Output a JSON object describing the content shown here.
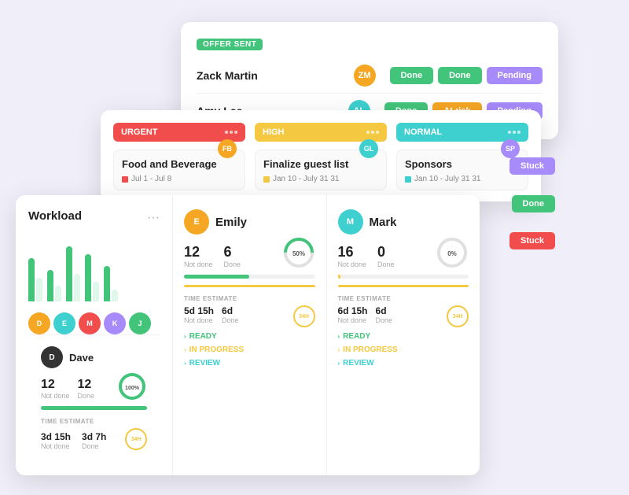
{
  "panels": {
    "back": {
      "badge": "OFFER SENT",
      "rows": [
        {
          "name": "Zack Martin",
          "avatarBg": "#f5a623",
          "initials": "ZM",
          "statuses": [
            "Done",
            "Done",
            "Pending"
          ]
        },
        {
          "name": "Amy Lee",
          "avatarBg": "#3ecfcf",
          "initials": "AL",
          "statuses": [
            "Done",
            "At risk",
            "Pending"
          ]
        }
      ],
      "statusColors": {
        "Done": "#43c47b",
        "At risk": "#f5a623",
        "Pending": "#a78bfa"
      }
    },
    "mid": {
      "columns": [
        {
          "id": "urgent",
          "label": "URGENT",
          "headerClass": "kanban-urgent",
          "card": {
            "title": "Food and Beverage",
            "date": "Jul 1 - Jul 8",
            "flagColor": "#f14d4d",
            "avatarBg": "#f5a623",
            "initials": "FB"
          }
        },
        {
          "id": "high",
          "label": "HIGH",
          "headerClass": "kanban-high",
          "card": {
            "title": "Finalize guest list",
            "date": "Jan 10 - July 31 31",
            "flagColor": "#f5a623",
            "avatarBg": "#3ecfcf",
            "initials": "GL"
          }
        },
        {
          "id": "normal",
          "label": "NORMAL",
          "headerClass": "kanban-normal",
          "card": {
            "title": "Sponsors",
            "date": "Jan 10 - July 31 31",
            "flagColor": "#3ecfcf",
            "avatarBg": "#a78bfa",
            "initials": "SP"
          }
        }
      ],
      "stuckLabel": "Stuck",
      "doneLabel": "Done"
    },
    "front": {
      "workload": {
        "title": "Workload",
        "dotsLabel": "...",
        "bars": [
          {
            "green": 55,
            "light": 30
          },
          {
            "green": 40,
            "light": 20
          },
          {
            "green": 70,
            "light": 35
          },
          {
            "green": 60,
            "light": 25
          },
          {
            "green": 45,
            "light": 15
          }
        ],
        "avatars": [
          {
            "bg": "#f5a623",
            "initials": "D"
          },
          {
            "bg": "#3ecfcf",
            "initials": "E"
          },
          {
            "bg": "#f14d4d",
            "initials": "M"
          },
          {
            "bg": "#a78bfa",
            "initials": "K"
          },
          {
            "bg": "#43c47b",
            "initials": "J"
          }
        ],
        "dave": {
          "name": "Dave",
          "avatarBg": "#222",
          "initials": "D",
          "notDone": "12",
          "done": "12",
          "progressPct": 100,
          "progressColor": "#43c47b",
          "timeLabel": "TIME ESTIMATE",
          "notDoneTime": "3d 15h",
          "doneTime": "3d 7h",
          "badgeLabel": "34H",
          "donutPct": 100,
          "donutColor": "#43c47b"
        }
      },
      "people": [
        {
          "name": "Emily",
          "avatarBg": "#f5a623",
          "initials": "E",
          "notDone": "12",
          "done": "6",
          "progressPct": 50,
          "progressColor": "#43c47b",
          "donutPct": 50,
          "donutColor": "#43c47b",
          "donutLabel": "50%",
          "timeLabel": "TIME ESTIMATE",
          "notDoneTime": "5d 15h",
          "doneTime": "6d",
          "badgeLabel": "34H",
          "accordion": [
            "READY",
            "IN PROGRESS",
            "REVIEW"
          ]
        },
        {
          "name": "Mark",
          "avatarBg": "#3ecfcf",
          "initials": "M",
          "notDone": "16",
          "done": "0",
          "progressPct": 0,
          "progressColor": "#f5c842",
          "donutPct": 0,
          "donutColor": "#e0e0e0",
          "donutLabel": "0%",
          "timeLabel": "TIME ESTIMATE",
          "notDoneTime": "6d 15h",
          "doneTime": "6d",
          "badgeLabel": "34H",
          "accordion": [
            "READY",
            "IN PROGRESS",
            "REVIEW"
          ]
        }
      ]
    }
  }
}
